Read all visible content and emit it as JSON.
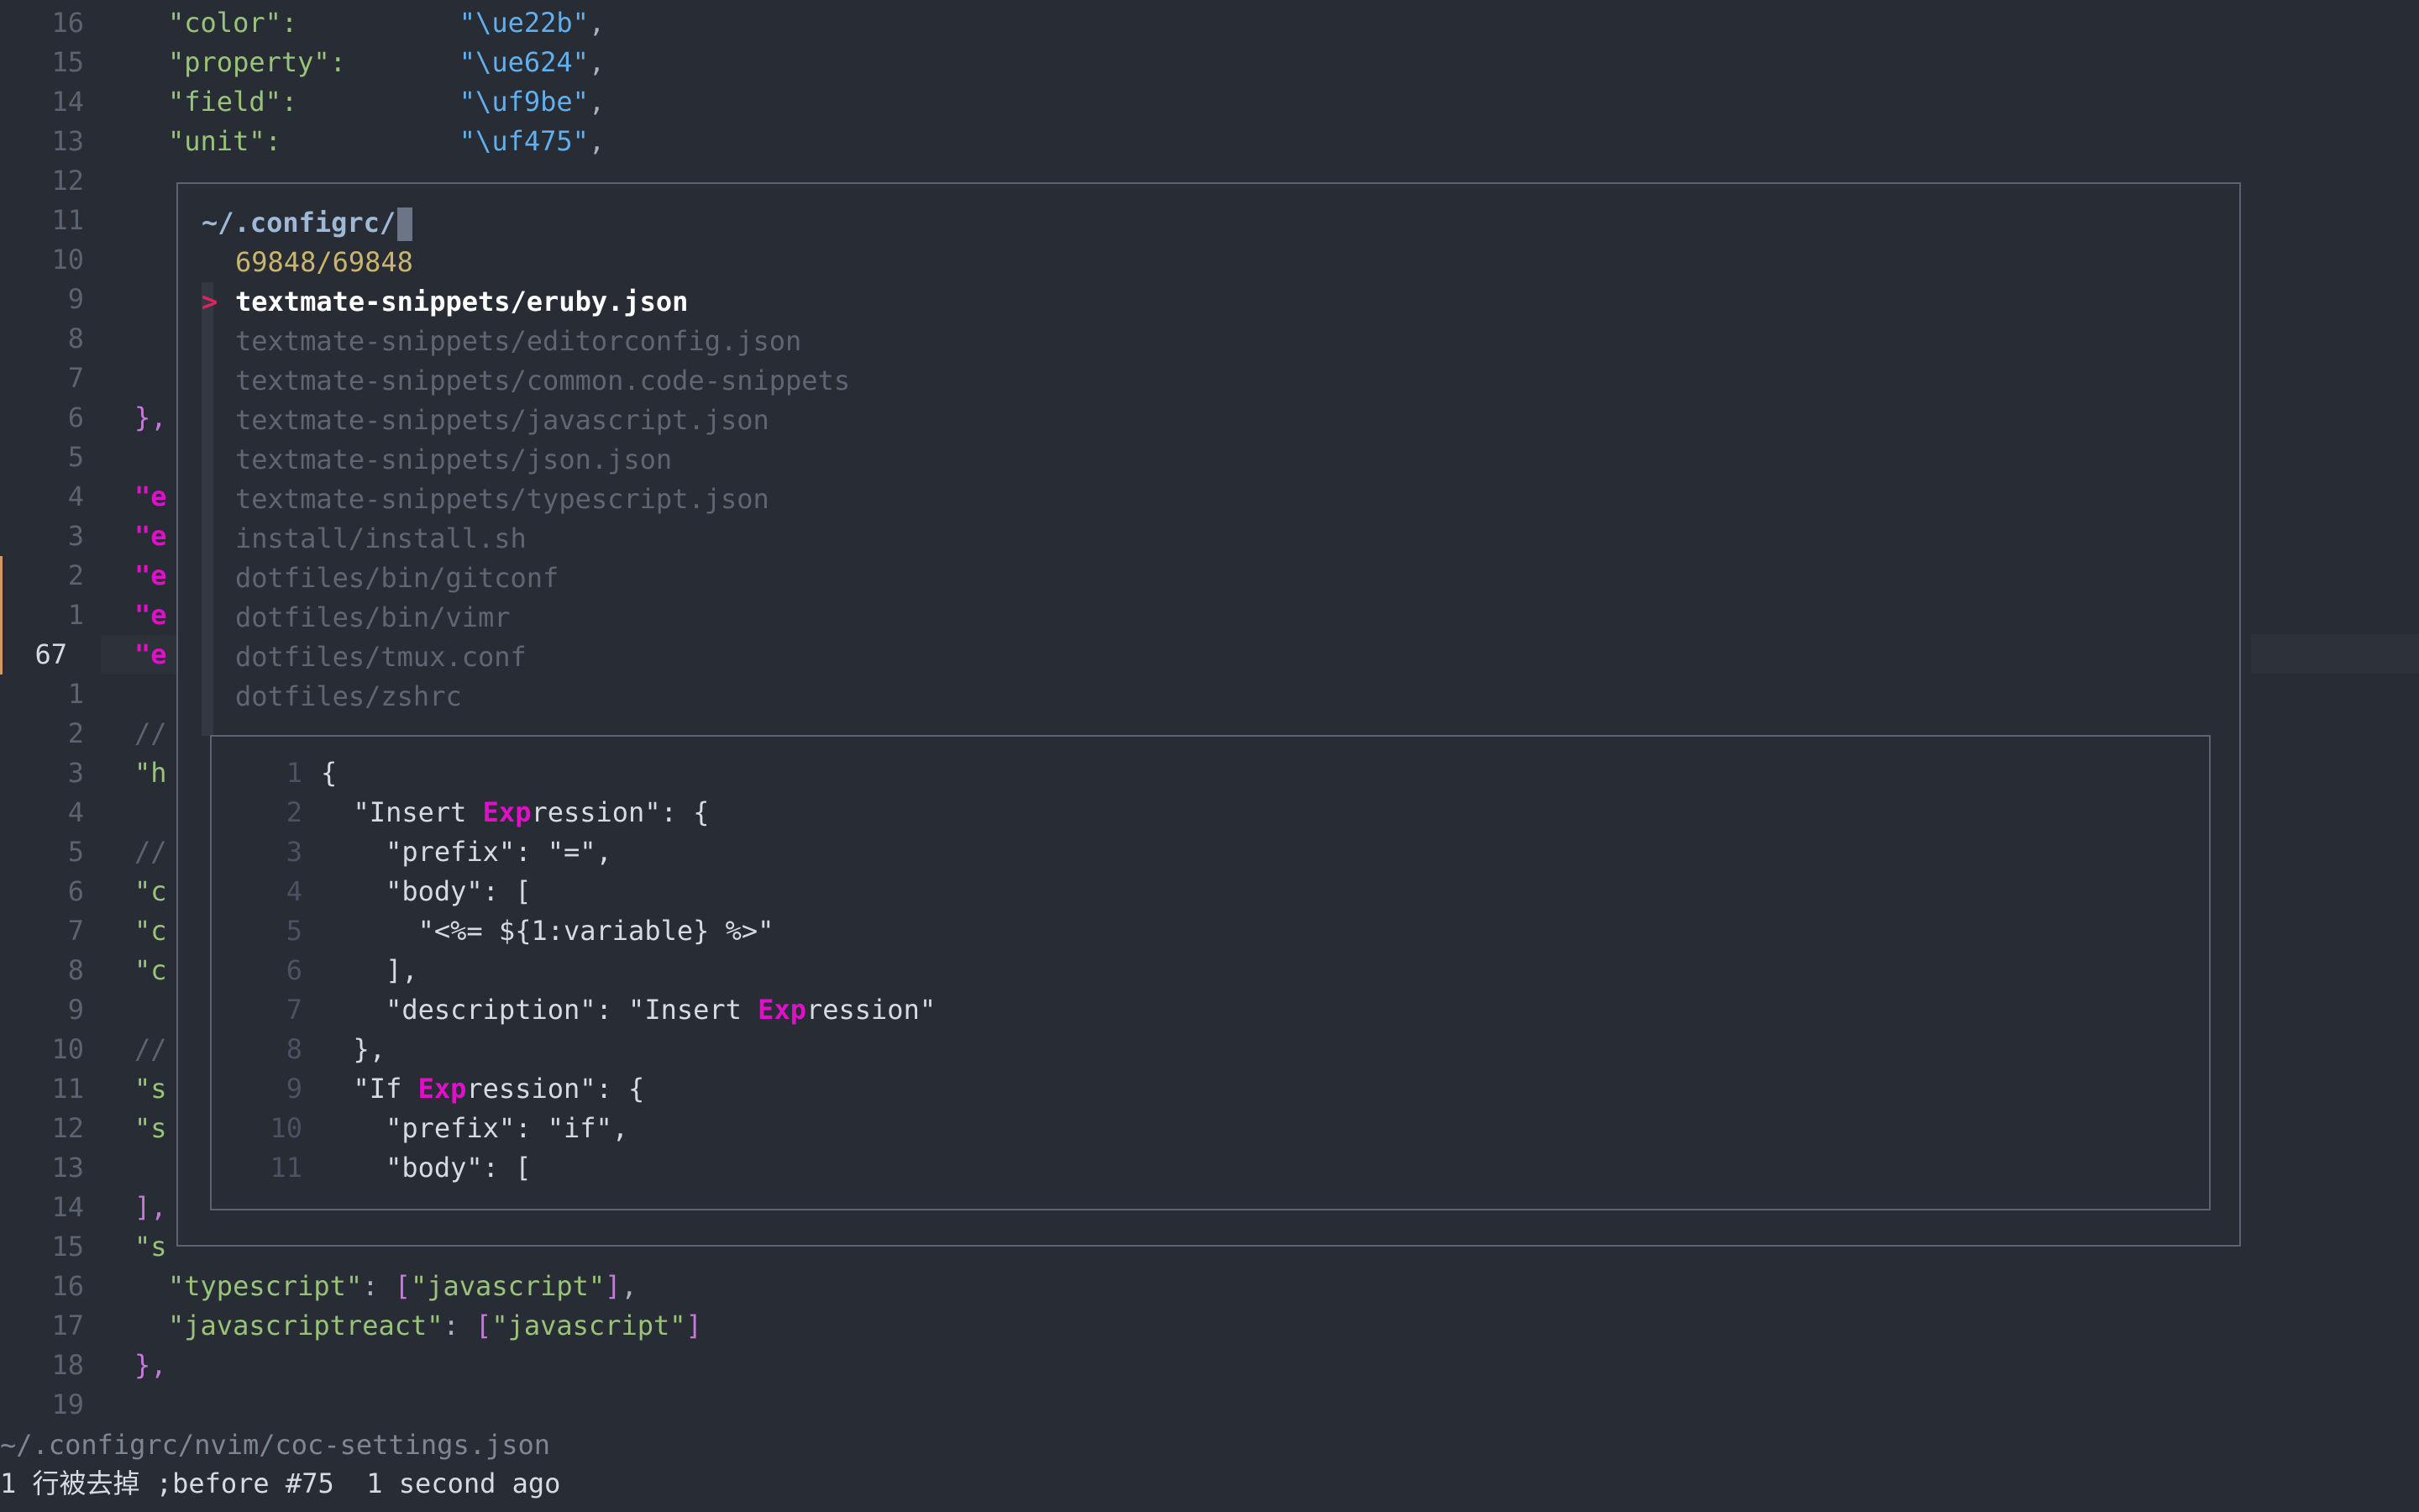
{
  "editor": {
    "top_lines": [
      {
        "num": "16",
        "key": "\"color\":",
        "pad": "          ",
        "val": "\"\\ue22b\"",
        "tail": ","
      },
      {
        "num": "15",
        "key": "\"property\":",
        "pad": "       ",
        "val": "\"\\ue624\"",
        "tail": ","
      },
      {
        "num": "14",
        "key": "\"field\":",
        "pad": "          ",
        "val": "\"\\uf9be\"",
        "tail": ","
      },
      {
        "num": "13",
        "key": "\"unit\":",
        "pad": "           ",
        "val": "\"\\uf475\"",
        "tail": ","
      }
    ],
    "left_lines": [
      {
        "num": "12",
        "text": ""
      },
      {
        "num": "11",
        "text": ""
      },
      {
        "num": "10",
        "text": ""
      },
      {
        "num": "9",
        "text": ""
      },
      {
        "num": "8",
        "text": ""
      },
      {
        "num": "7",
        "text": ""
      },
      {
        "num": "6",
        "text": "},"
      },
      {
        "num": "5",
        "text": ""
      },
      {
        "num": "4",
        "text": "\"e"
      },
      {
        "num": "3",
        "text": "\"e"
      },
      {
        "num": "2",
        "text": "\"e"
      },
      {
        "num": "1",
        "text": "\"e"
      },
      {
        "num": "67",
        "text": "\"e"
      },
      {
        "num": "1",
        "text": ""
      },
      {
        "num": "2",
        "text": "//"
      },
      {
        "num": "3",
        "text": "\"h"
      },
      {
        "num": "4",
        "text": ""
      },
      {
        "num": "5",
        "text": "//"
      },
      {
        "num": "6",
        "text": "\"c"
      },
      {
        "num": "7",
        "text": "\"c"
      },
      {
        "num": "8",
        "text": "\"c"
      },
      {
        "num": "9",
        "text": ""
      },
      {
        "num": "10",
        "text": "//"
      },
      {
        "num": "11",
        "text": "\"s"
      },
      {
        "num": "12",
        "text": "\"s"
      },
      {
        "num": "13",
        "text": ""
      },
      {
        "num": "14",
        "text": "],"
      },
      {
        "num": "15",
        "text": "\"s"
      }
    ],
    "bottom_lines": [
      {
        "num": "16",
        "key": "\"typescript\"",
        "val": "\"javascript\""
      },
      {
        "num": "17",
        "key": "\"javascriptreact\"",
        "val": "\"javascript\""
      }
    ],
    "line18": {
      "num": "18",
      "text": "},"
    },
    "line19": {
      "num": "19",
      "text": ""
    },
    "status_file": "~/.configrc/nvim/coc-settings.json",
    "message": "1 行被去掉 ;before #75  1 second ago"
  },
  "finder": {
    "prompt": "~/.configrc/",
    "count": "69848/69848",
    "pointer": ">",
    "items": [
      "textmate-snippets/eruby.json",
      "textmate-snippets/editorconfig.json",
      "textmate-snippets/common.code-snippets",
      "textmate-snippets/javascript.json",
      "textmate-snippets/json.json",
      "textmate-snippets/typescript.json",
      "install/install.sh",
      "dotfiles/bin/gitconf",
      "dotfiles/bin/vimr",
      "dotfiles/tmux.conf",
      "dotfiles/zshrc"
    ],
    "preview": [
      {
        "num": "1",
        "pre": "{",
        "hl": "",
        "post": ""
      },
      {
        "num": "2",
        "pre": "  \"Insert ",
        "hl": "Exp",
        "post": "ression\": {"
      },
      {
        "num": "3",
        "pre": "    \"prefix\": \"=\",",
        "hl": "",
        "post": ""
      },
      {
        "num": "4",
        "pre": "    \"body\": [",
        "hl": "",
        "post": ""
      },
      {
        "num": "5",
        "pre": "      \"<%= ${1:variable} %>\"",
        "hl": "",
        "post": ""
      },
      {
        "num": "6",
        "pre": "    ],",
        "hl": "",
        "post": ""
      },
      {
        "num": "7",
        "pre": "    \"description\": \"Insert ",
        "hl": "Exp",
        "post": "ression\""
      },
      {
        "num": "8",
        "pre": "  },",
        "hl": "",
        "post": ""
      },
      {
        "num": "9",
        "pre": "  \"If ",
        "hl": "Exp",
        "post": "ression\": {"
      },
      {
        "num": "10",
        "pre": "    \"prefix\": \"if\",",
        "hl": "",
        "post": ""
      },
      {
        "num": "11",
        "pre": "    \"body\": [",
        "hl": "",
        "post": ""
      }
    ]
  }
}
